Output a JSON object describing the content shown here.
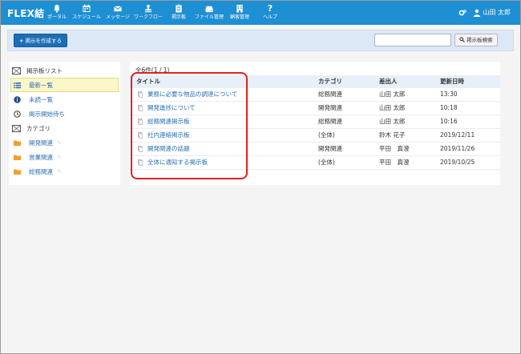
{
  "app": {
    "brand": "FLEX結",
    "user_name": "山田 太郎"
  },
  "nav": {
    "items": [
      {
        "label": "ポータル",
        "icon": "bell-icon"
      },
      {
        "label": "スケジュール",
        "icon": "calendar-icon"
      },
      {
        "label": "メッセージ",
        "icon": "envelope-icon"
      },
      {
        "label": "ワークフロー",
        "icon": "stamp-icon"
      },
      {
        "label": "掲示板",
        "icon": "clipboard-icon"
      },
      {
        "label": "ファイル管理",
        "icon": "hdd-icon"
      },
      {
        "label": "顧客管理",
        "icon": "building-icon"
      },
      {
        "label": "ヘルプ",
        "icon": "question-icon"
      }
    ]
  },
  "toolbar": {
    "create_label": "掲示を作成する",
    "search_placeholder": "",
    "search_button_label": "掲示板検索"
  },
  "sidebar": {
    "list_header": "掲示板リスト",
    "list_items": [
      {
        "label": "最新一覧",
        "icon": "list-icon",
        "active": true
      },
      {
        "label": "未読一覧",
        "icon": "info-circle-icon",
        "active": false
      },
      {
        "label": "掲示開始待ち",
        "icon": "clock-icon",
        "active": false
      }
    ],
    "category_header": "カテゴリ",
    "categories": [
      {
        "label": "開発関連",
        "icon": "folder-icon"
      },
      {
        "label": "営業関連",
        "icon": "folder-icon"
      },
      {
        "label": "総務関連",
        "icon": "folder-icon"
      }
    ]
  },
  "main": {
    "count_text": "全6件(1 / 1)",
    "columns": {
      "title": "タイトル",
      "category": "カテゴリ",
      "sender": "差出人",
      "updated": "更新日時"
    },
    "rows": [
      {
        "title": "業務に必要な物品の調達について",
        "category": "総務関連",
        "sender": "山田 太郎",
        "updated": "13:30"
      },
      {
        "title": "開発進捗について",
        "category": "開発関連",
        "sender": "山田 太郎",
        "updated": "10:18"
      },
      {
        "title": "総務関連掲示板",
        "category": "総務関連",
        "sender": "山田 太郎",
        "updated": "10:16"
      },
      {
        "title": "社内連絡掲示板",
        "category": "(全体)",
        "sender": "鈴木 花子",
        "updated": "2019/12/11"
      },
      {
        "title": "開発関連の話題",
        "category": "開発関連",
        "sender": "平田　真澄",
        "updated": "2019/11/26"
      },
      {
        "title": "全体に通知する掲示板",
        "category": "(全体)",
        "sender": "平田　真澄",
        "updated": "2019/10/25"
      }
    ]
  },
  "colors": {
    "nav_bg": "#1e8fd2",
    "toolbar_bg": "#dbe8f6",
    "primary_button": "#1d6fb5",
    "link": "#2a6fb0",
    "active_item_bg": "#fdf6c9",
    "folder": "#f0a030",
    "highlight": "#e41f1f"
  }
}
